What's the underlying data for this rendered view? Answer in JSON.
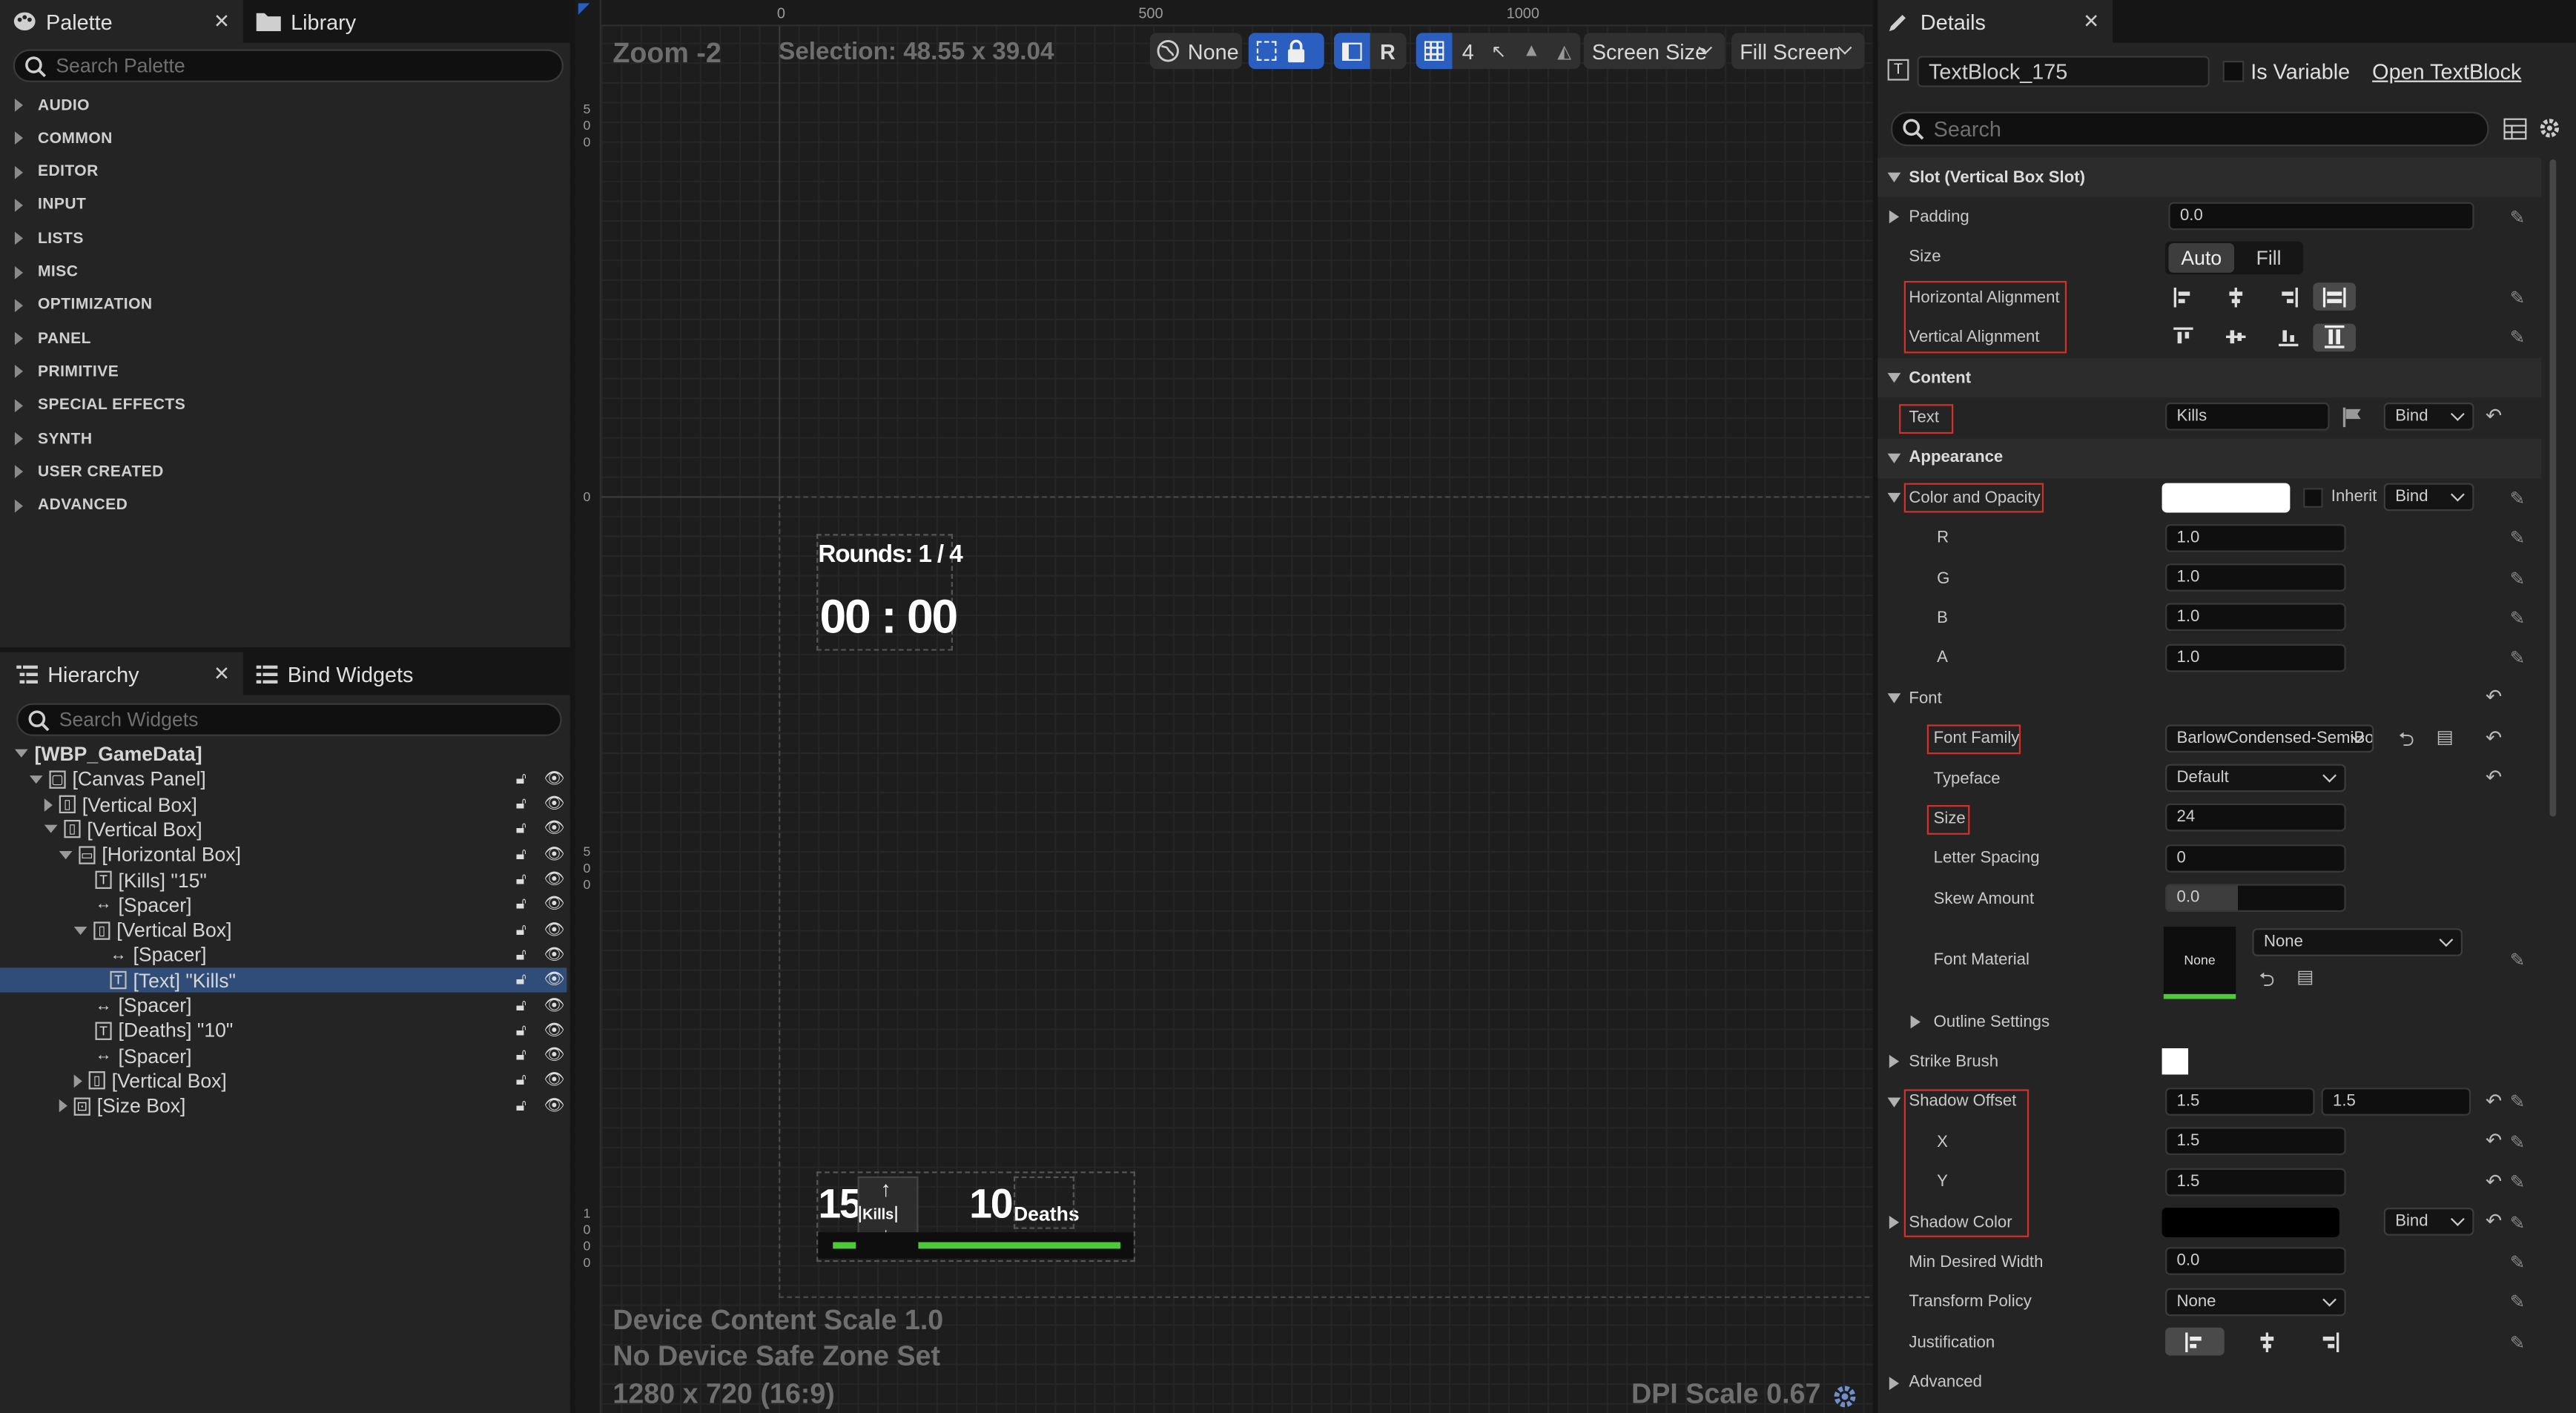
{
  "palette": {
    "tab_label": "Palette",
    "library_tab": "Library",
    "search_placeholder": "Search Palette",
    "categories": [
      "AUDIO",
      "COMMON",
      "EDITOR",
      "INPUT",
      "LISTS",
      "MISC",
      "OPTIMIZATION",
      "PANEL",
      "PRIMITIVE",
      "SPECIAL EFFECTS",
      "SYNTH",
      "USER CREATED",
      "ADVANCED"
    ]
  },
  "hierarchy": {
    "tab_label": "Hierarchy",
    "bind_tab": "Bind Widgets",
    "search_placeholder": "Search Widgets",
    "root": "[WBP_GameData]",
    "items": [
      {
        "label": "[Canvas Panel]",
        "depth": 1,
        "expand": "down",
        "icon": "canvas"
      },
      {
        "label": "[Vertical Box]",
        "depth": 2,
        "expand": "right",
        "icon": "vbox"
      },
      {
        "label": "[Vertical Box]",
        "depth": 2,
        "expand": "down",
        "icon": "vbox"
      },
      {
        "label": "[Horizontal Box]",
        "depth": 3,
        "expand": "down",
        "icon": "hbox"
      },
      {
        "label": "[Kills] \"15\"",
        "depth": 4,
        "expand": "",
        "icon": "text"
      },
      {
        "label": "[Spacer]",
        "depth": 4,
        "expand": "",
        "icon": "spacer"
      },
      {
        "label": "[Vertical Box]",
        "depth": 4,
        "expand": "down",
        "icon": "vbox"
      },
      {
        "label": "[Spacer]",
        "depth": 5,
        "expand": "",
        "icon": "spacer"
      },
      {
        "label": "[Text] \"Kills\"",
        "depth": 5,
        "expand": "",
        "icon": "text",
        "selected": true
      },
      {
        "label": "[Spacer]",
        "depth": 4,
        "expand": "",
        "icon": "spacer"
      },
      {
        "label": "[Deaths] \"10\"",
        "depth": 4,
        "expand": "",
        "icon": "text"
      },
      {
        "label": "[Spacer]",
        "depth": 4,
        "expand": "",
        "icon": "spacer"
      },
      {
        "label": "[Vertical Box]",
        "depth": 4,
        "expand": "right",
        "icon": "vbox"
      },
      {
        "label": "[Size Box]",
        "depth": 3,
        "expand": "right",
        "icon": "sizebox"
      }
    ]
  },
  "viewport": {
    "zoom": "Zoom -2",
    "selection": "Selection: 48.55 x 39.04",
    "ruler_top": [
      "0",
      "500",
      "1000"
    ],
    "ruler_left": [
      "5\n0\n0",
      "0",
      "5\n0\n0",
      "1\n0\n0\n0"
    ],
    "toolbar": {
      "none_label": "None",
      "r_label": "R",
      "grid_value": "4",
      "screen_size": "Screen Size",
      "fill_screen": "Fill Screen"
    },
    "rounds": "Rounds: 1 / 4",
    "timer": "00 : 00",
    "kills_value": "15",
    "kills_label": "Kills",
    "deaths_value": "10",
    "deaths_label": "Deaths",
    "device_scale": "Device Content Scale 1.0",
    "safe_zone": "No Device Safe Zone Set",
    "resolution": "1280 x 720 (16:9)",
    "dpi": "DPI Scale 0.67",
    "colors": {
      "accent_green": "#4ec93a",
      "selection_blue": "#2a5fc0"
    }
  },
  "details": {
    "tab_label": "Details",
    "widget_name": "TextBlock_175",
    "is_variable": "Is Variable",
    "open_link": "Open TextBlock",
    "search_placeholder": "Search",
    "slot_section": "Slot (Vertical Box Slot)",
    "padding_label": "Padding",
    "padding_value": "0.0",
    "size_label": "Size",
    "size_auto": "Auto",
    "size_fill": "Fill",
    "halign_label": "Horizontal Alignment",
    "valign_label": "Vertical Alignment",
    "content_section": "Content",
    "text_label": "Text",
    "text_value": "Kills",
    "bind": "Bind",
    "appearance_section": "Appearance",
    "color_label": "Color and Opacity",
    "inherit": "Inherit",
    "r_label": "R",
    "r_value": "1.0",
    "g_label": "G",
    "g_value": "1.0",
    "b_label": "B",
    "b_value": "1.0",
    "a_label": "A",
    "a_value": "1.0",
    "font_label": "Font",
    "font_family_label": "Font Family",
    "font_family_value": "BarlowCondensed-SemiBold",
    "typeface_label": "Typeface",
    "typeface_value": "Default",
    "font_size_label": "Size",
    "font_size_value": "24",
    "letter_spacing_label": "Letter Spacing",
    "letter_spacing_value": "0",
    "skew_label": "Skew Amount",
    "skew_value": "0.0",
    "font_material_label": "Font Material",
    "font_material_thumb": "None",
    "font_material_value": "None",
    "outline_label": "Outline Settings",
    "strike_label": "Strike Brush",
    "shadow_offset_label": "Shadow Offset",
    "shadow_offset_x_val": "1.5",
    "shadow_offset_y_val": "1.5",
    "x_label": "X",
    "x_value": "1.5",
    "y_label": "Y",
    "y_value": "1.5",
    "shadow_color_label": "Shadow Color",
    "min_width_label": "Min Desired Width",
    "min_width_value": "0.0",
    "transform_label": "Transform Policy",
    "transform_value": "None",
    "justification_label": "Justification",
    "advanced_label": "Advanced"
  }
}
